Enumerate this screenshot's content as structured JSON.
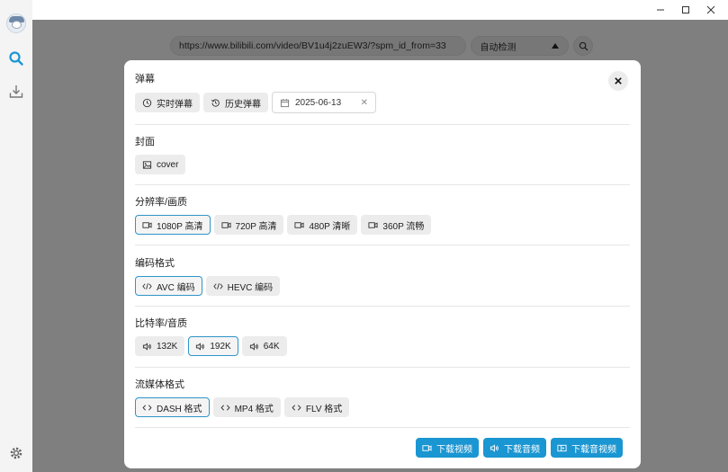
{
  "window": {
    "controls": [
      "minimize",
      "maximize",
      "close"
    ]
  },
  "sidebar": {
    "items": [
      {
        "icon": "avatar"
      },
      {
        "icon": "search-icon"
      },
      {
        "icon": "download-icon"
      },
      {
        "icon": "settings-icon"
      }
    ]
  },
  "topbar": {
    "url_value": "https://www.bilibili.com/video/BV1u4j2zuEW3/?spm_id_from=33",
    "mode_value": "自动检测"
  },
  "dialog": {
    "danmaku": {
      "title": "弹幕",
      "realtime_label": "实时弹幕",
      "history_label": "历史弹幕",
      "date_value": "2025-06-13",
      "date_clear": "✕"
    },
    "cover": {
      "title": "封面",
      "cover_label": "cover"
    },
    "resolution": {
      "title": "分辨率/画质",
      "options": [
        "1080P 高清",
        "720P 高清",
        "480P 清晰",
        "360P 流畅"
      ],
      "selected": "1080P 高清"
    },
    "codec": {
      "title": "编码格式",
      "options": [
        "AVC 编码",
        "HEVC 编码"
      ],
      "selected": "AVC 编码"
    },
    "bitrate": {
      "title": "比特率/音质",
      "options": [
        "132K",
        "192K",
        "64K"
      ],
      "selected": "192K"
    },
    "stream": {
      "title": "流媒体格式",
      "options": [
        "DASH 格式",
        "MP4 格式",
        "FLV 格式"
      ],
      "selected": "DASH 格式"
    },
    "footer": {
      "download_video": "下载视频",
      "download_audio": "下载音频",
      "download_av": "下载音视频"
    }
  },
  "colors": {
    "accent": "#1a96d2",
    "selected_border": "#2f95c9",
    "chip_bg": "#ececec"
  }
}
